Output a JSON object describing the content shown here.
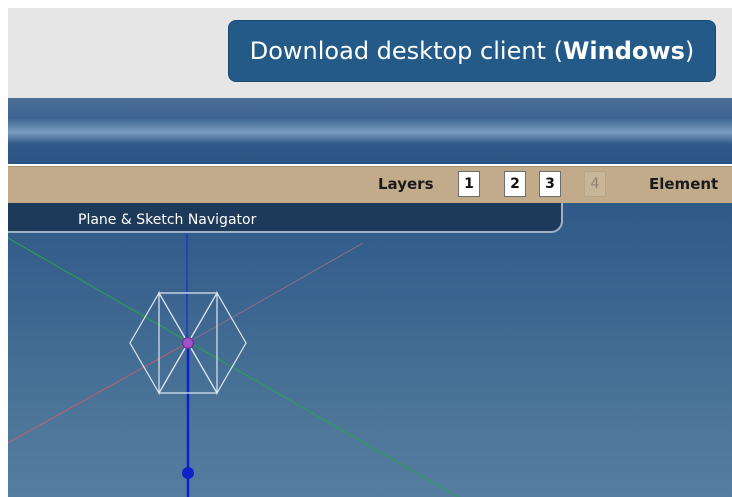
{
  "download_button": {
    "prefix": "Download desktop client (",
    "os": "Windows",
    "suffix": ")"
  },
  "layers_bar": {
    "label": "Layers",
    "layers": [
      "1",
      "2",
      "3",
      "4"
    ],
    "element_label": "Element"
  },
  "navigator": {
    "title": "Plane & Sketch Navigator"
  },
  "colors": {
    "button_bg": "#235a87",
    "layers_bar_bg": "#c2ab8b",
    "viewport_bg": "#3c6690",
    "axis_x": "#c06070",
    "axis_y": "#2aa34a",
    "axis_z": "#1c2cd6"
  }
}
